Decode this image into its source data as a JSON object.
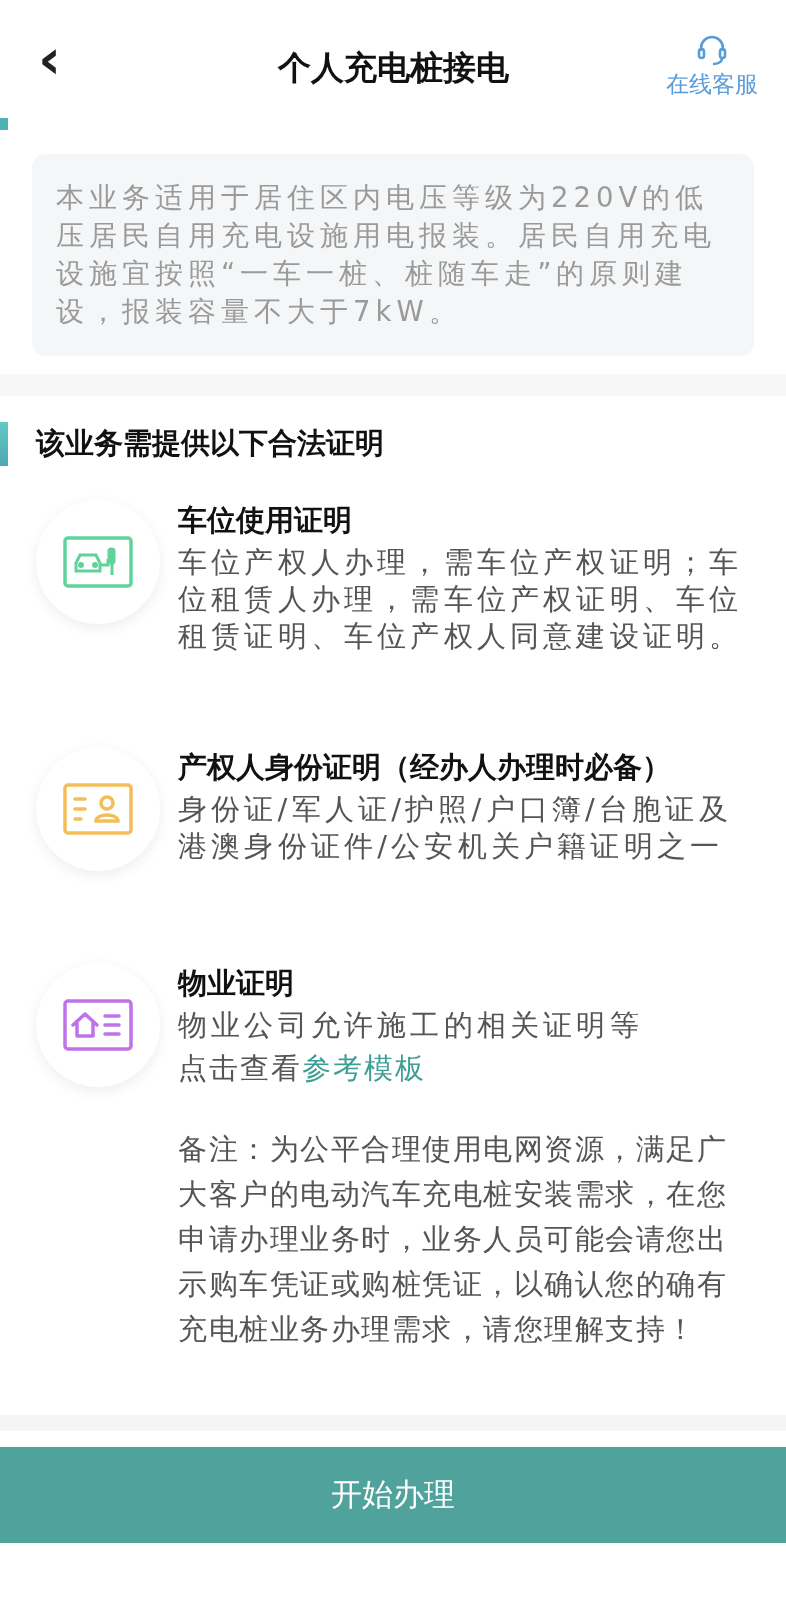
{
  "header": {
    "back": "‹",
    "title": "个人充电桩接电",
    "service": "在线客服"
  },
  "intro": "本业务适用于居住区内电压等级为220V的低压居民自用充电设施用电报装。居民自用充电设施宜按照“一车一桩、桩随车走”的原则建设，报装容量不大于7kW。",
  "section": {
    "title": "该业务需提供以下合法证明"
  },
  "items": [
    {
      "kind": "parking",
      "color": "#5fd39a",
      "title": "车位使用证明",
      "desc": "车位产权人办理，需车位产权证明；车位租赁人办理，需车位产权证明、车位租赁证明、车位产权人同意建设证明。"
    },
    {
      "kind": "id",
      "color": "#f3be5a",
      "title": "产权人身份证明（经办人办理时必备）",
      "desc": "身份证/军人证/护照/户口簿/台胞证及港澳身份证件/公安机关户籍证明之一"
    },
    {
      "kind": "property",
      "color": "#bf72ea",
      "title": "物业证明",
      "desc": "物业公司允许施工的相关证明等",
      "hint": "点击查看",
      "link": "参考模板"
    }
  ],
  "note": "备注：为公平合理使用电网资源，满足广大客户的电动汽车充电桩安装需求，在您申请办理业务时，业务人员可能会请您出示购车凭证或购桩凭证，以确认您的确有充电桩业务办理需求，请您理解支持！",
  "button": "开始办理"
}
